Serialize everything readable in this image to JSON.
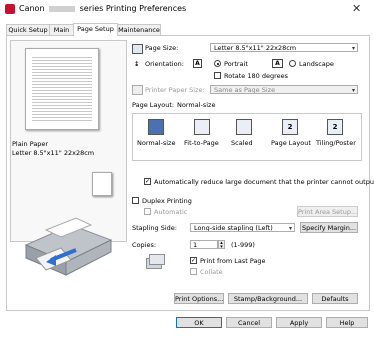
{
  "window": {
    "title_left": "Canon",
    "title_right": "series Printing Preferences",
    "close_label": "✕"
  },
  "tabs": [
    {
      "label": "Quick Setup"
    },
    {
      "label": "Main"
    },
    {
      "label": "Page Setup"
    },
    {
      "label": "Maintenance"
    }
  ],
  "preview": {
    "paper_name": "Plain Paper",
    "paper_size": "Letter 8.5\"x11\" 22x28cm"
  },
  "page_size": {
    "label": "Page Size:",
    "value": "Letter 8.5\"x11\" 22x28cm"
  },
  "orientation": {
    "label": "Orientation:",
    "portrait": "Portrait",
    "landscape": "Landscape",
    "rotate": "Rotate 180 degrees",
    "selected": "portrait"
  },
  "printer_paper_size": {
    "label": "Printer Paper Size:",
    "value": "Same as Page Size"
  },
  "page_layout": {
    "label": "Page Layout:",
    "current": "Normal-size",
    "options": [
      {
        "label": "Normal-size",
        "selected": true
      },
      {
        "label": "Fit-to-Page",
        "selected": false
      },
      {
        "label": "Scaled",
        "selected": false
      },
      {
        "label": "Page Layout",
        "selected": false
      },
      {
        "label": "Tiling/Poster",
        "selected": false
      }
    ]
  },
  "auto_reduce": {
    "label": "Automatically reduce large document that the printer cannot output",
    "checked": true
  },
  "duplex": {
    "label": "Duplex Printing",
    "automatic": "Automatic",
    "print_area_setup": "Print Area Setup..."
  },
  "stapling": {
    "label": "Stapling Side:",
    "value": "Long-side stapling (Left)",
    "specify_margin": "Specify Margin..."
  },
  "copies": {
    "label": "Copies:",
    "value": "1",
    "range": "(1-999)",
    "print_from_last": "Print from Last Page",
    "collate": "Collate"
  },
  "bottom_buttons": {
    "print_options": "Print Options...",
    "stamp_background": "Stamp/Background...",
    "defaults": "Defaults"
  },
  "dialog_buttons": {
    "ok": "OK",
    "cancel": "Cancel",
    "apply": "Apply",
    "help": "Help"
  },
  "icons": {
    "portrait_glyph": "A",
    "landscape_glyph": "A",
    "layout_glyph": "2"
  }
}
